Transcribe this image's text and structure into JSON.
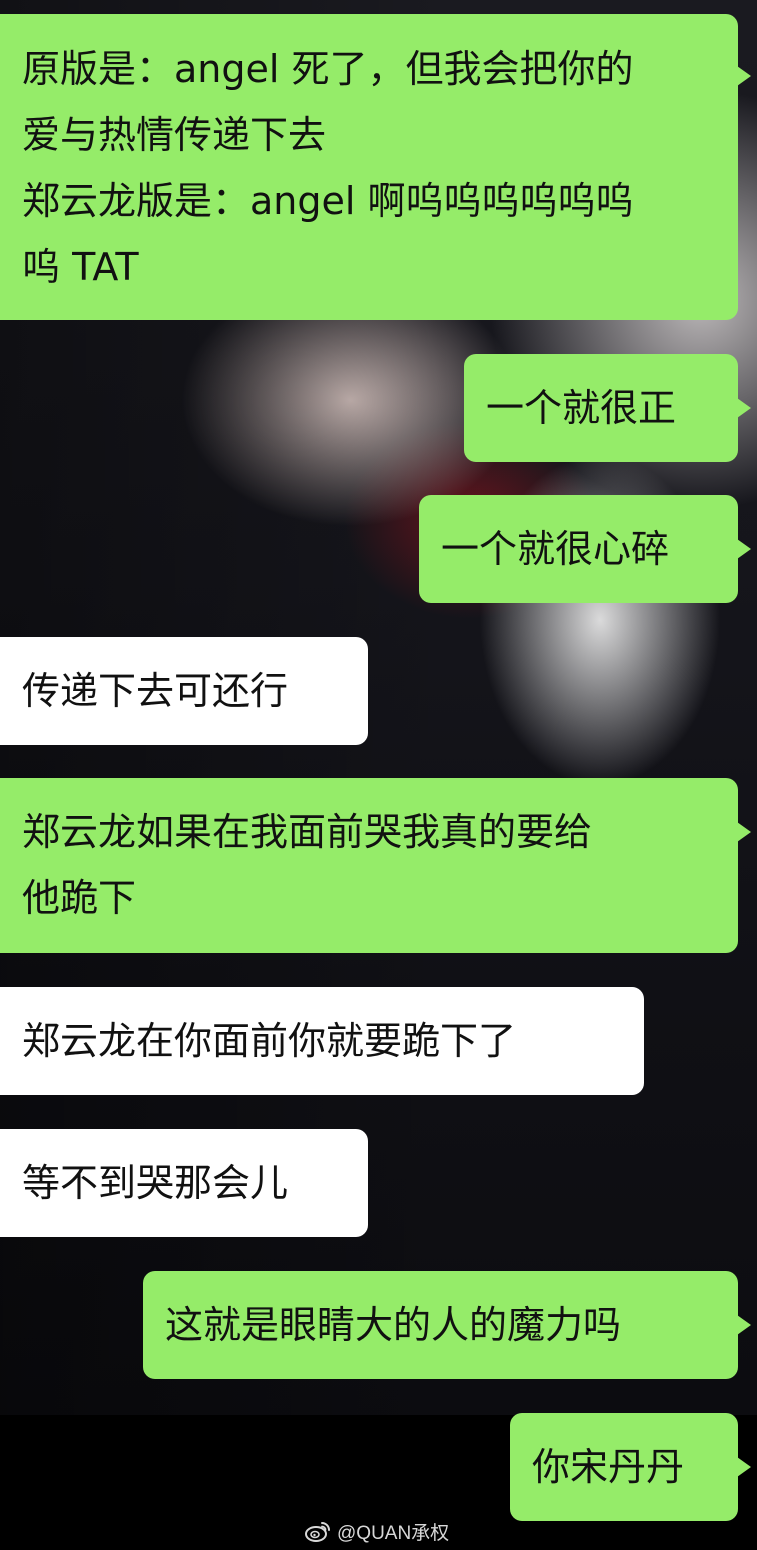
{
  "chat": {
    "messages": [
      {
        "sender": "me",
        "lines": [
          "原版是：angel 死了，但我会把你的",
          "爱与热情传递下去",
          "郑云龙版是：angel 啊呜呜呜呜呜呜",
          "呜 TAT"
        ]
      },
      {
        "sender": "me",
        "lines": [
          "一个就很正"
        ]
      },
      {
        "sender": "me",
        "lines": [
          "一个就很心碎"
        ]
      },
      {
        "sender": "friend",
        "lines": [
          "传递下去可还行"
        ]
      },
      {
        "sender": "me",
        "lines": [
          "郑云龙如果在我面前哭我真的要给",
          "他跪下"
        ]
      },
      {
        "sender": "friend",
        "lines": [
          "郑云龙在你面前你就要跪下了"
        ]
      },
      {
        "sender": "friend",
        "lines": [
          "等不到哭那会儿"
        ]
      },
      {
        "sender": "me",
        "lines": [
          "这就是眼睛大的人的魔力吗"
        ]
      },
      {
        "sender": "me",
        "lines": [
          "你宋丹丹"
        ]
      }
    ]
  },
  "watermark": {
    "icon": "weibo-logo-icon",
    "text": "@QUAN承权"
  },
  "colors": {
    "sent_bubble": "#95ec69",
    "received_bubble": "#ffffff",
    "text": "#111111",
    "watermark_text": "#d8d8d8"
  }
}
